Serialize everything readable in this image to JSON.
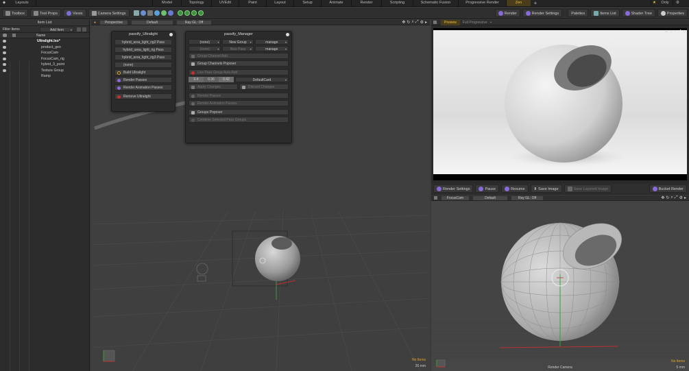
{
  "topbar": {
    "layouts_label": "Layouts",
    "tabs": [
      "Model",
      "Topology",
      "UVEdit",
      "Paint",
      "Layout",
      "Setup",
      "Animate",
      "Render",
      "Scripting",
      "Schematic Fusion",
      "Progressive Render",
      "Zen"
    ],
    "active_tab": "Zen",
    "only_label": "Only"
  },
  "toolbar": {
    "left_buttons": [
      "Toolbox",
      "Tool Props",
      "Views",
      "Camera Settings"
    ],
    "right_buttons": [
      "Render",
      "Render Settings",
      "Palettes",
      "Items List",
      "Shader Tree",
      "Properties"
    ]
  },
  "item_list": {
    "title": "Item List",
    "filter_label": "Filter Items",
    "add_item_label": "Add Item",
    "name_header": "Name",
    "items": [
      {
        "label": "Ultralight.lxo*",
        "indent": 0
      },
      {
        "label": "product_geo",
        "indent": 1
      },
      {
        "label": "FocusCam",
        "indent": 1
      },
      {
        "label": "FocusCam_rig",
        "indent": 1
      },
      {
        "label": "hybrid_3_point",
        "indent": 1
      },
      {
        "label": "Texture Group",
        "indent": 1
      },
      {
        "label": "Ramp",
        "indent": 1
      }
    ]
  },
  "left_viewport": {
    "view_label": "Perspective",
    "style_label": "Default",
    "raygl_label": "Ray GL: Off",
    "status_top": "No Items",
    "status_bottom": "20 mm"
  },
  "ultralight_panel": {
    "title": "passify_Ultralight",
    "passes": [
      "hybrid_area_light_rig2 Pass",
      "hybrid_area_light_rig Pass",
      "hybrid_area_light_rig3 Pass",
      "(none)"
    ],
    "actions": [
      "Build Ultralight",
      "Render Passes",
      "Render Animation Passes"
    ],
    "remove_label": "Remove Ultralight"
  },
  "manager_panel": {
    "title": "passify_Manager",
    "row1": {
      "select": "(none)",
      "new_group": "New Group",
      "manage": "manage"
    },
    "row2": {
      "select": "(none)",
      "new_pass": "New Pass",
      "manage": "manage"
    },
    "group_channel_add": "Group Channel Add",
    "group_channels_popover": "Group Channels Popover",
    "live_pass_toggle": "Live Pass Group Auto Add",
    "color_values": [
      "0.4",
      "0.36",
      "0.42"
    ],
    "default_card": "DefaultCard",
    "apply_changes": "Apply Changes",
    "discard_changes": "Discard Changes",
    "render_passes": "Render Passes",
    "render_animation_passes": "Render Animation Passes",
    "groups_popover": "Groups Popover",
    "combine_selected": "Combine Selected Pass Groups"
  },
  "preview": {
    "tabs": [
      "Preview",
      "Full Progressive"
    ],
    "buttons": [
      "Render Settings",
      "Pause",
      "Resume",
      "Save Image",
      "Save Layered Image"
    ],
    "bucket_render": "Bucket Render"
  },
  "cam_viewport": {
    "view_label": "FocusCam",
    "style_label": "Default",
    "raygl_label": "Ray GL: Off",
    "bottom_label": "Render Camera",
    "status_top": "No Items",
    "status_bottom": "5 mm"
  }
}
